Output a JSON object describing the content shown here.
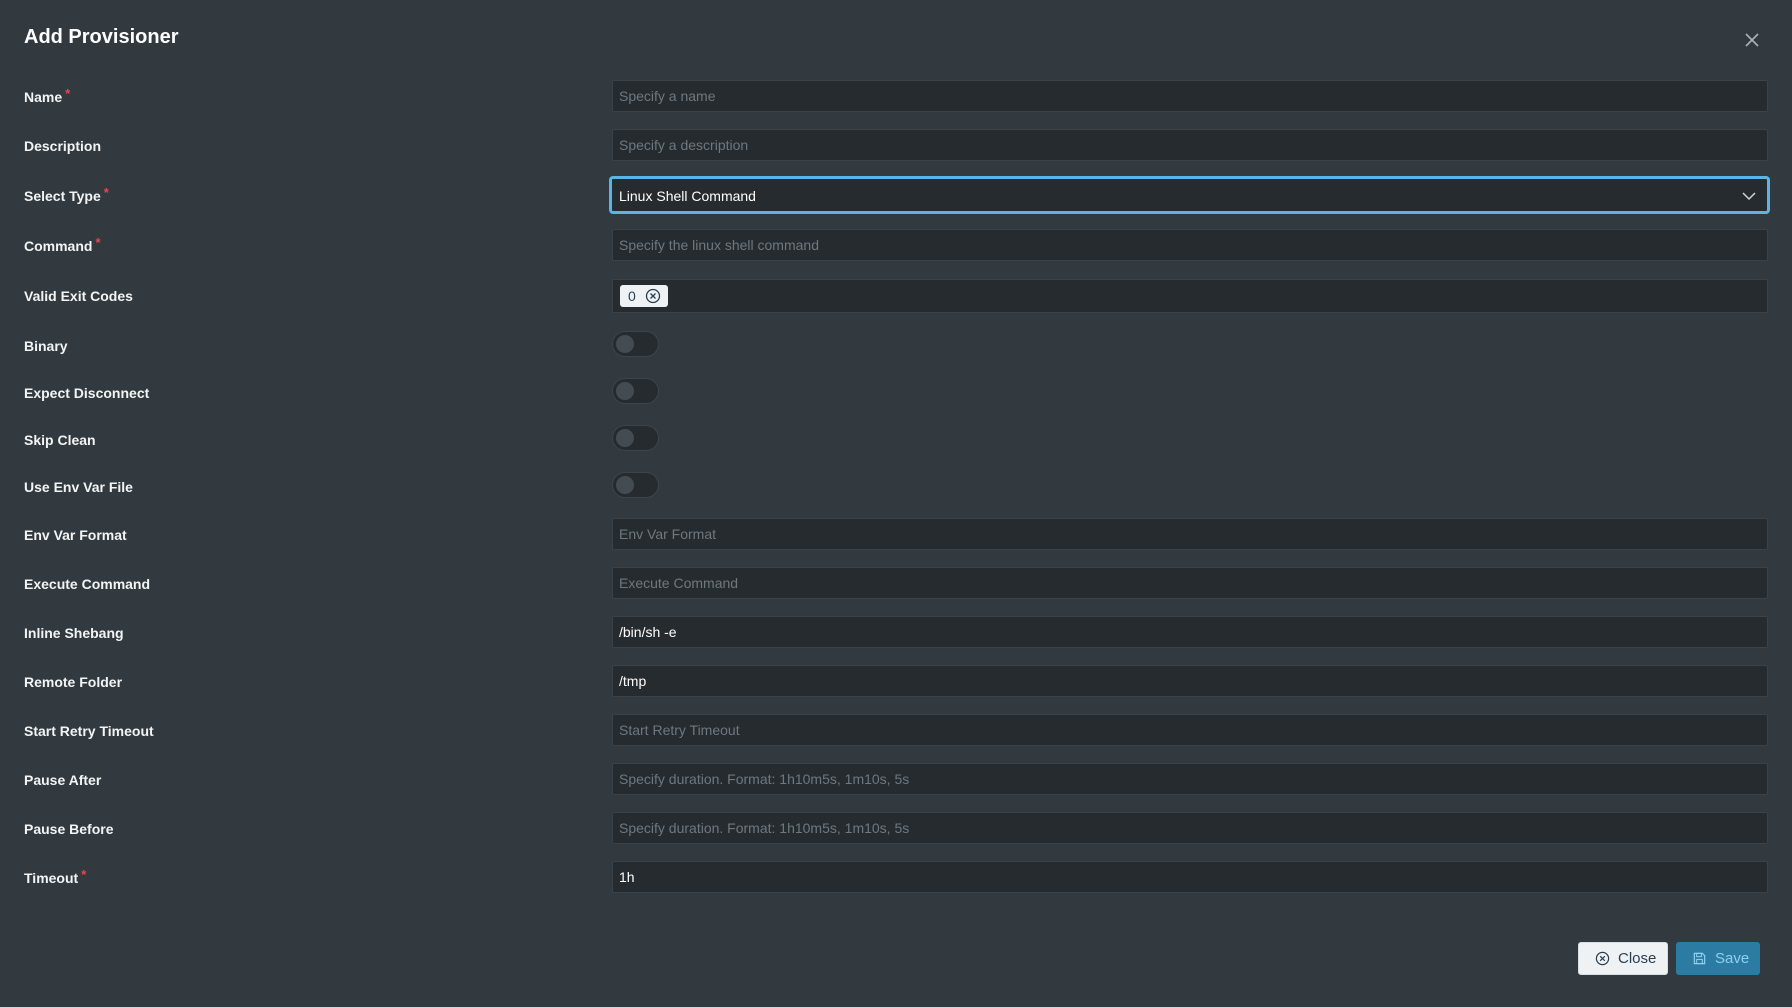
{
  "dialog": {
    "title": "Add Provisioner",
    "close_icon": "close-icon"
  },
  "fields": {
    "name": {
      "label": "Name",
      "required": "*",
      "placeholder": "Specify a name",
      "value": ""
    },
    "description": {
      "label": "Description",
      "placeholder": "Specify a description",
      "value": ""
    },
    "select_type": {
      "label": "Select Type",
      "required": "*",
      "value": "Linux Shell Command",
      "icon": "chevron-down-icon"
    },
    "command": {
      "label": "Command",
      "required": "*",
      "placeholder": "Specify the linux shell command",
      "value": ""
    },
    "valid_exit_codes": {
      "label": "Valid Exit Codes",
      "tags": [
        "0"
      ],
      "tag_remove_icon": "circle-x-icon"
    },
    "binary": {
      "label": "Binary",
      "on": false
    },
    "expect_disconnect": {
      "label": "Expect Disconnect",
      "on": false
    },
    "skip_clean": {
      "label": "Skip Clean",
      "on": false
    },
    "use_env_var_file": {
      "label": "Use Env Var File",
      "on": false
    },
    "env_var_format": {
      "label": "Env Var Format",
      "placeholder": "Env Var Format",
      "value": ""
    },
    "execute_command": {
      "label": "Execute Command",
      "placeholder": "Execute Command",
      "value": ""
    },
    "inline_shebang": {
      "label": "Inline Shebang",
      "value": "/bin/sh -e"
    },
    "remote_folder": {
      "label": "Remote Folder",
      "value": "/tmp"
    },
    "start_retry_timeout": {
      "label": "Start Retry Timeout",
      "placeholder": "Start Retry Timeout",
      "value": ""
    },
    "pause_after": {
      "label": "Pause After",
      "placeholder": "Specify duration. Format: 1h10m5s, 1m10s, 5s",
      "value": ""
    },
    "pause_before": {
      "label": "Pause Before",
      "placeholder": "Specify duration. Format: 1h10m5s, 1m10s, 5s",
      "value": ""
    },
    "timeout": {
      "label": "Timeout",
      "required": "*",
      "value": "1h"
    }
  },
  "footer": {
    "close_label": "Close",
    "close_icon": "circle-x-icon",
    "save_label": "Save",
    "save_icon": "floppy-disk-icon"
  },
  "colors": {
    "background": "#323a3f",
    "input_background": "#262b2f",
    "focus_border": "#5ab4e6",
    "required": "#e5484d",
    "save_button": "#2b7ba3"
  }
}
